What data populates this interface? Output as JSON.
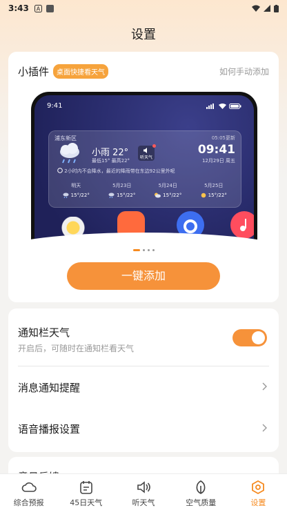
{
  "status_bar": {
    "time": "3:43"
  },
  "page": {
    "title": "设置"
  },
  "widget_card": {
    "label": "小插件",
    "tag": "桌面快捷看天气",
    "help_link": "如何手动添加",
    "preview": {
      "phone_time": "9:41",
      "location": "浦东新区",
      "updated": "05:05更新",
      "condition": "小雨 22°",
      "range": "最低15° 最高22°",
      "listen_btn": "听天气",
      "clock": "09:41",
      "date": "12月29日 周五",
      "tip": "2小时内不会降水，最近的降雨带在东边92公里外呢",
      "days": [
        {
          "label": "明天",
          "temp": "15°/22°"
        },
        {
          "label": "5月23日",
          "temp": "15°/22°"
        },
        {
          "label": "5月24日",
          "temp": "15°/22°"
        },
        {
          "label": "5月25日",
          "temp": "15°/22°"
        }
      ]
    },
    "add_button": "一键添加"
  },
  "settings": {
    "notify_weather": {
      "title": "通知栏天气",
      "subtitle": "开启后，可随时在通知栏看天气",
      "enabled": true
    },
    "message_alert": {
      "title": "消息通知提醒"
    },
    "voice_broadcast": {
      "title": "语音播报设置"
    },
    "feedback": {
      "title": "意见反馈"
    }
  },
  "tabbar": [
    {
      "label": "综合预报",
      "icon": "cloud-icon"
    },
    {
      "label": "45日天气",
      "icon": "calendar-icon"
    },
    {
      "label": "听天气",
      "icon": "speaker-icon"
    },
    {
      "label": "空气质量",
      "icon": "leaf-icon"
    },
    {
      "label": "设置",
      "icon": "settings-icon",
      "active": true
    }
  ],
  "colors": {
    "accent": "#f6923a",
    "tab_active": "#f68a1f"
  }
}
